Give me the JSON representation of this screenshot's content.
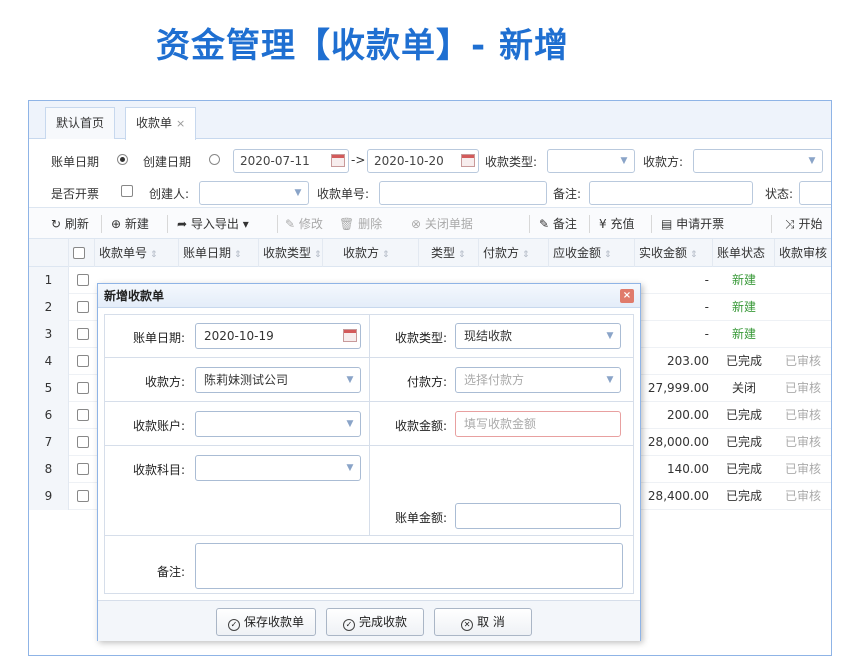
{
  "headline": "资金管理【收款单】- 新增",
  "tabs": [
    {
      "label": "默认首页"
    },
    {
      "label": "收款单",
      "close": "×"
    }
  ],
  "filters": {
    "bill_date_label": "账单日期",
    "create_date_label": "创建日期",
    "date_from": "2020-07-11",
    "arrow": "->",
    "date_to": "2020-10-20",
    "receipt_type_label": "收款类型:",
    "payee_label": "收款方:",
    "invoiced_label": "是否开票",
    "creator_label": "创建人:",
    "receipt_no_label": "收款单号:",
    "remark_label": "备注:",
    "status_label": "状态:"
  },
  "toolbar": {
    "refresh": "刷新",
    "new": "新建",
    "import_export": "导入导出",
    "edit": "修改",
    "delete": "删除",
    "close_bill": "关闭单据",
    "remark": "备注",
    "recharge": "充值",
    "invoice": "申请开票",
    "start": "开始"
  },
  "grid": {
    "headers": [
      "收款单号",
      "账单日期",
      "收款类型",
      "收款方",
      "类型",
      "付款方",
      "应收金额",
      "实收金额",
      "账单状态",
      "收款审核"
    ],
    "rows": [
      {
        "n": "1",
        "actual": "-",
        "status": "新建",
        "audit": ""
      },
      {
        "n": "2",
        "actual": "-",
        "status": "新建",
        "audit": ""
      },
      {
        "n": "3",
        "actual": "-",
        "status": "新建",
        "audit": ""
      },
      {
        "n": "4",
        "actual": "203.00",
        "status": "已完成",
        "audit": "已审核"
      },
      {
        "n": "5",
        "actual": "27,999.00",
        "status": "关闭",
        "audit": "已审核"
      },
      {
        "n": "6",
        "actual": "200.00",
        "status": "已完成",
        "audit": "已审核"
      },
      {
        "n": "7",
        "actual": "28,000.00",
        "status": "已完成",
        "audit": "已审核"
      },
      {
        "n": "8",
        "actual": "140.00",
        "status": "已完成",
        "audit": "已审核"
      },
      {
        "n": "9",
        "actual": "28,400.00",
        "status": "已完成",
        "audit": "已审核"
      }
    ]
  },
  "dialog": {
    "title": "新增收款单",
    "close": "×",
    "bill_date_label": "账单日期:",
    "bill_date_value": "2020-10-19",
    "receipt_type_label": "收款类型:",
    "receipt_type_value": "现结收款",
    "payee_label": "收款方:",
    "payee_value": "陈莉妹测试公司",
    "payer_label": "付款方:",
    "payer_placeholder": "选择付款方",
    "account_label": "收款账户:",
    "amount_label": "收款金额:",
    "amount_placeholder": "填写收款金额",
    "subject_label": "收款科目:",
    "bill_amount_label": "账单金额:",
    "remark_label": "备注:",
    "buttons": {
      "save": "保存收款单",
      "complete": "完成收款",
      "cancel": "取 消"
    }
  },
  "colors": {
    "accent": "#1f6fd1",
    "status_new": "#3a9a3a",
    "border": "#8fb4e6"
  }
}
